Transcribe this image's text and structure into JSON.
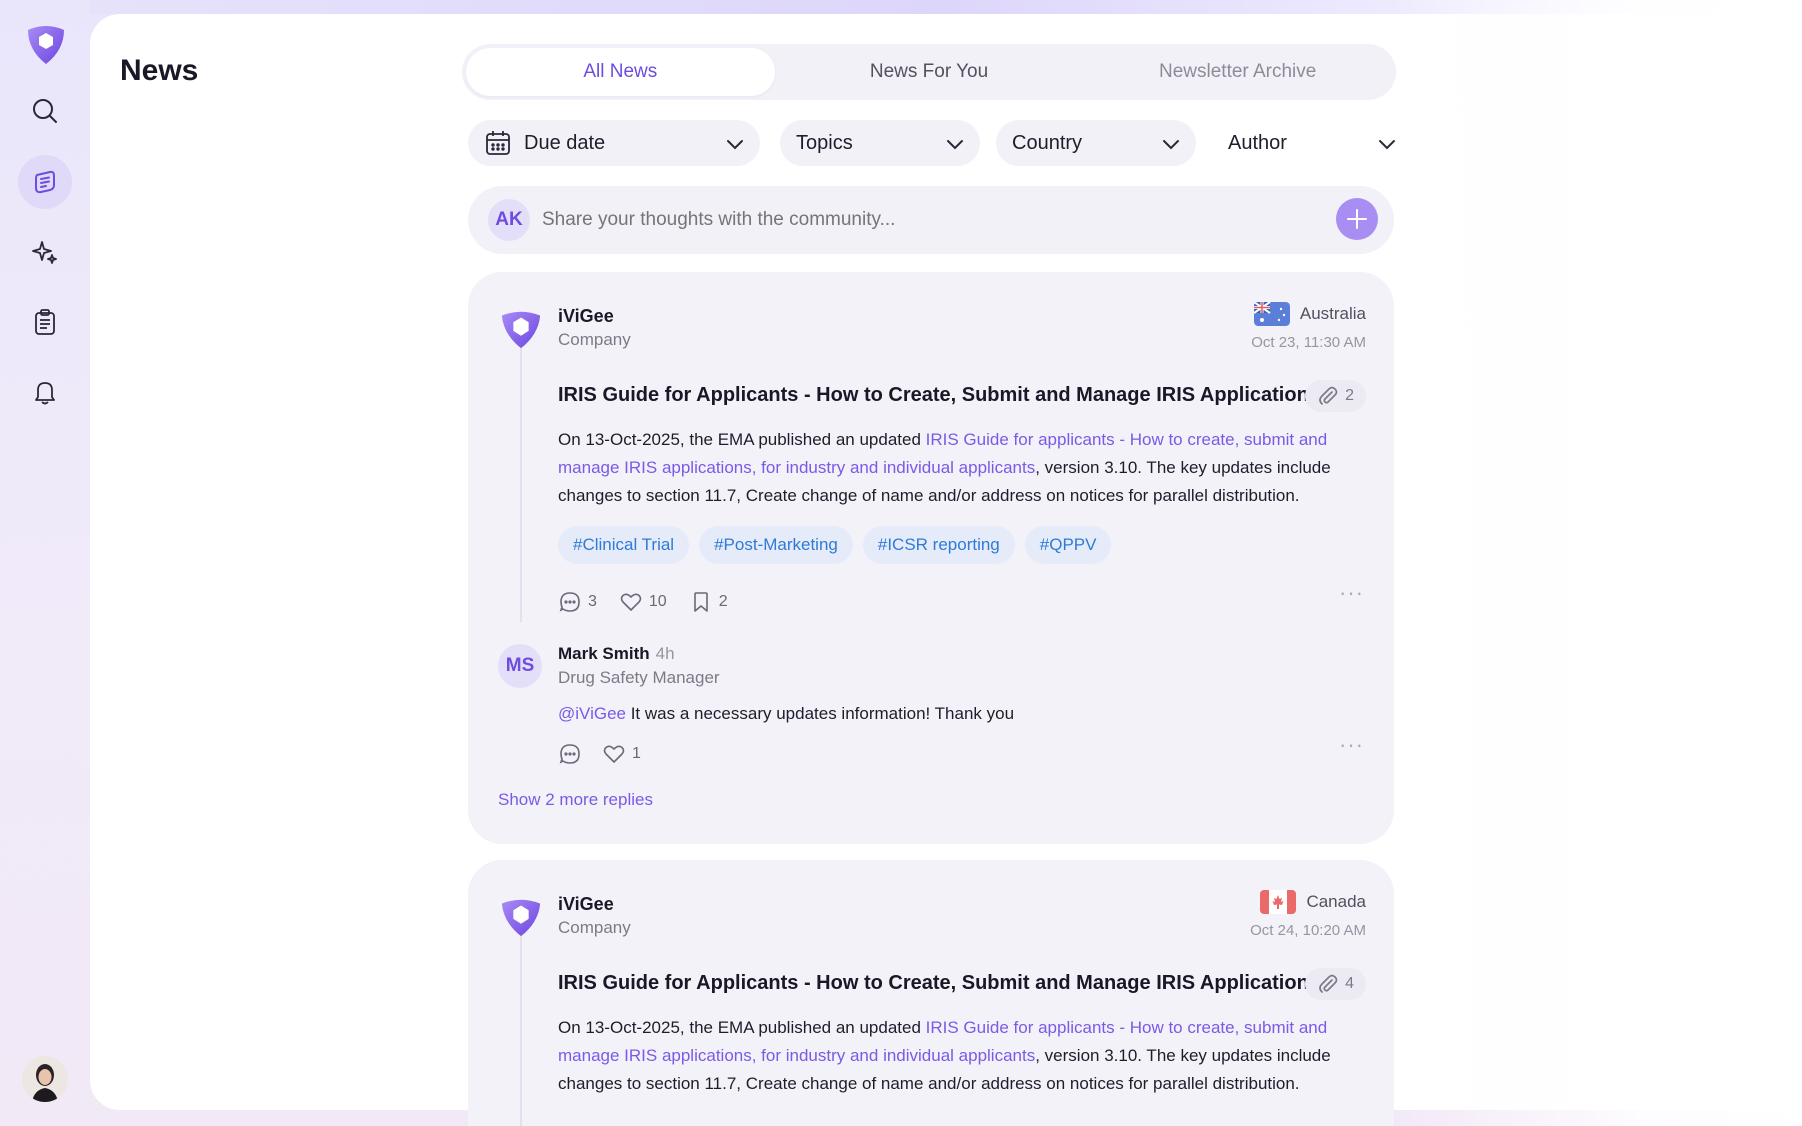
{
  "page": {
    "title": "News"
  },
  "sidebar": {
    "items": [
      {
        "name": "search",
        "icon": "search-icon"
      },
      {
        "name": "news",
        "icon": "news-icon",
        "active": true
      },
      {
        "name": "ai",
        "icon": "sparkle-icon"
      },
      {
        "name": "tasks",
        "icon": "clipboard-icon"
      },
      {
        "name": "notifications",
        "icon": "bell-icon"
      }
    ]
  },
  "tabs": [
    {
      "label": "All News",
      "active": true
    },
    {
      "label": "News For You"
    },
    {
      "label": "Newsletter Archive"
    }
  ],
  "filters": {
    "due_date": "Due date",
    "topics": "Topics",
    "country": "Country",
    "author": "Author"
  },
  "composer": {
    "initials": "AK",
    "placeholder": "Share your thoughts with the community..."
  },
  "posts": [
    {
      "company": "iViGee",
      "company_type": "Company",
      "country": "Australia",
      "date": "Oct 23, 11:30 AM",
      "title": "IRIS Guide for Applicants - How to Create, Submit and Manage IRIS Applications",
      "attachments": "2",
      "body_pre": "On 13-Oct-2025, the EMA published an updated ",
      "body_link": "IRIS Guide for applicants - How to create, submit and manage IRIS applications, for industry and individual applicants",
      "body_post": ", version 3.10. The key updates include changes to section 11.7, Create change of name and/or address on notices for parallel distribution.",
      "tags": [
        "#Clinical Trial",
        "#Post-Marketing",
        "#ICSR reporting",
        "#QPPV"
      ],
      "comments": "3",
      "likes": "10",
      "saves": "2",
      "reply": {
        "initials": "MS",
        "name": "Mark Smith",
        "time": "4h",
        "role": "Drug Safety Manager",
        "mention": "@iViGee",
        "text": " It was a necessary updates information! Thank you",
        "likes": "1"
      },
      "show_more": "Show 2 more replies"
    },
    {
      "company": "iViGee",
      "company_type": "Company",
      "country": "Canada",
      "date": "Oct 24, 10:20 AM",
      "title": "IRIS Guide for Applicants - How to Create, Submit and Manage IRIS Applications",
      "attachments": "4",
      "body_pre": "On 13-Oct-2025, the EMA published an updated ",
      "body_link": "IRIS Guide for applicants - How to create, submit and manage IRIS applications, for industry and individual applicants",
      "body_post": ", version 3.10. The key updates include changes to section 11.7, Create change of name and/or address on notices for parallel distribution."
    }
  ],
  "colors": {
    "accent": "#6e4ce0",
    "link": "#7a5ae6",
    "tag_text": "#2e7bd6",
    "card_bg": "#f3f2f9"
  }
}
